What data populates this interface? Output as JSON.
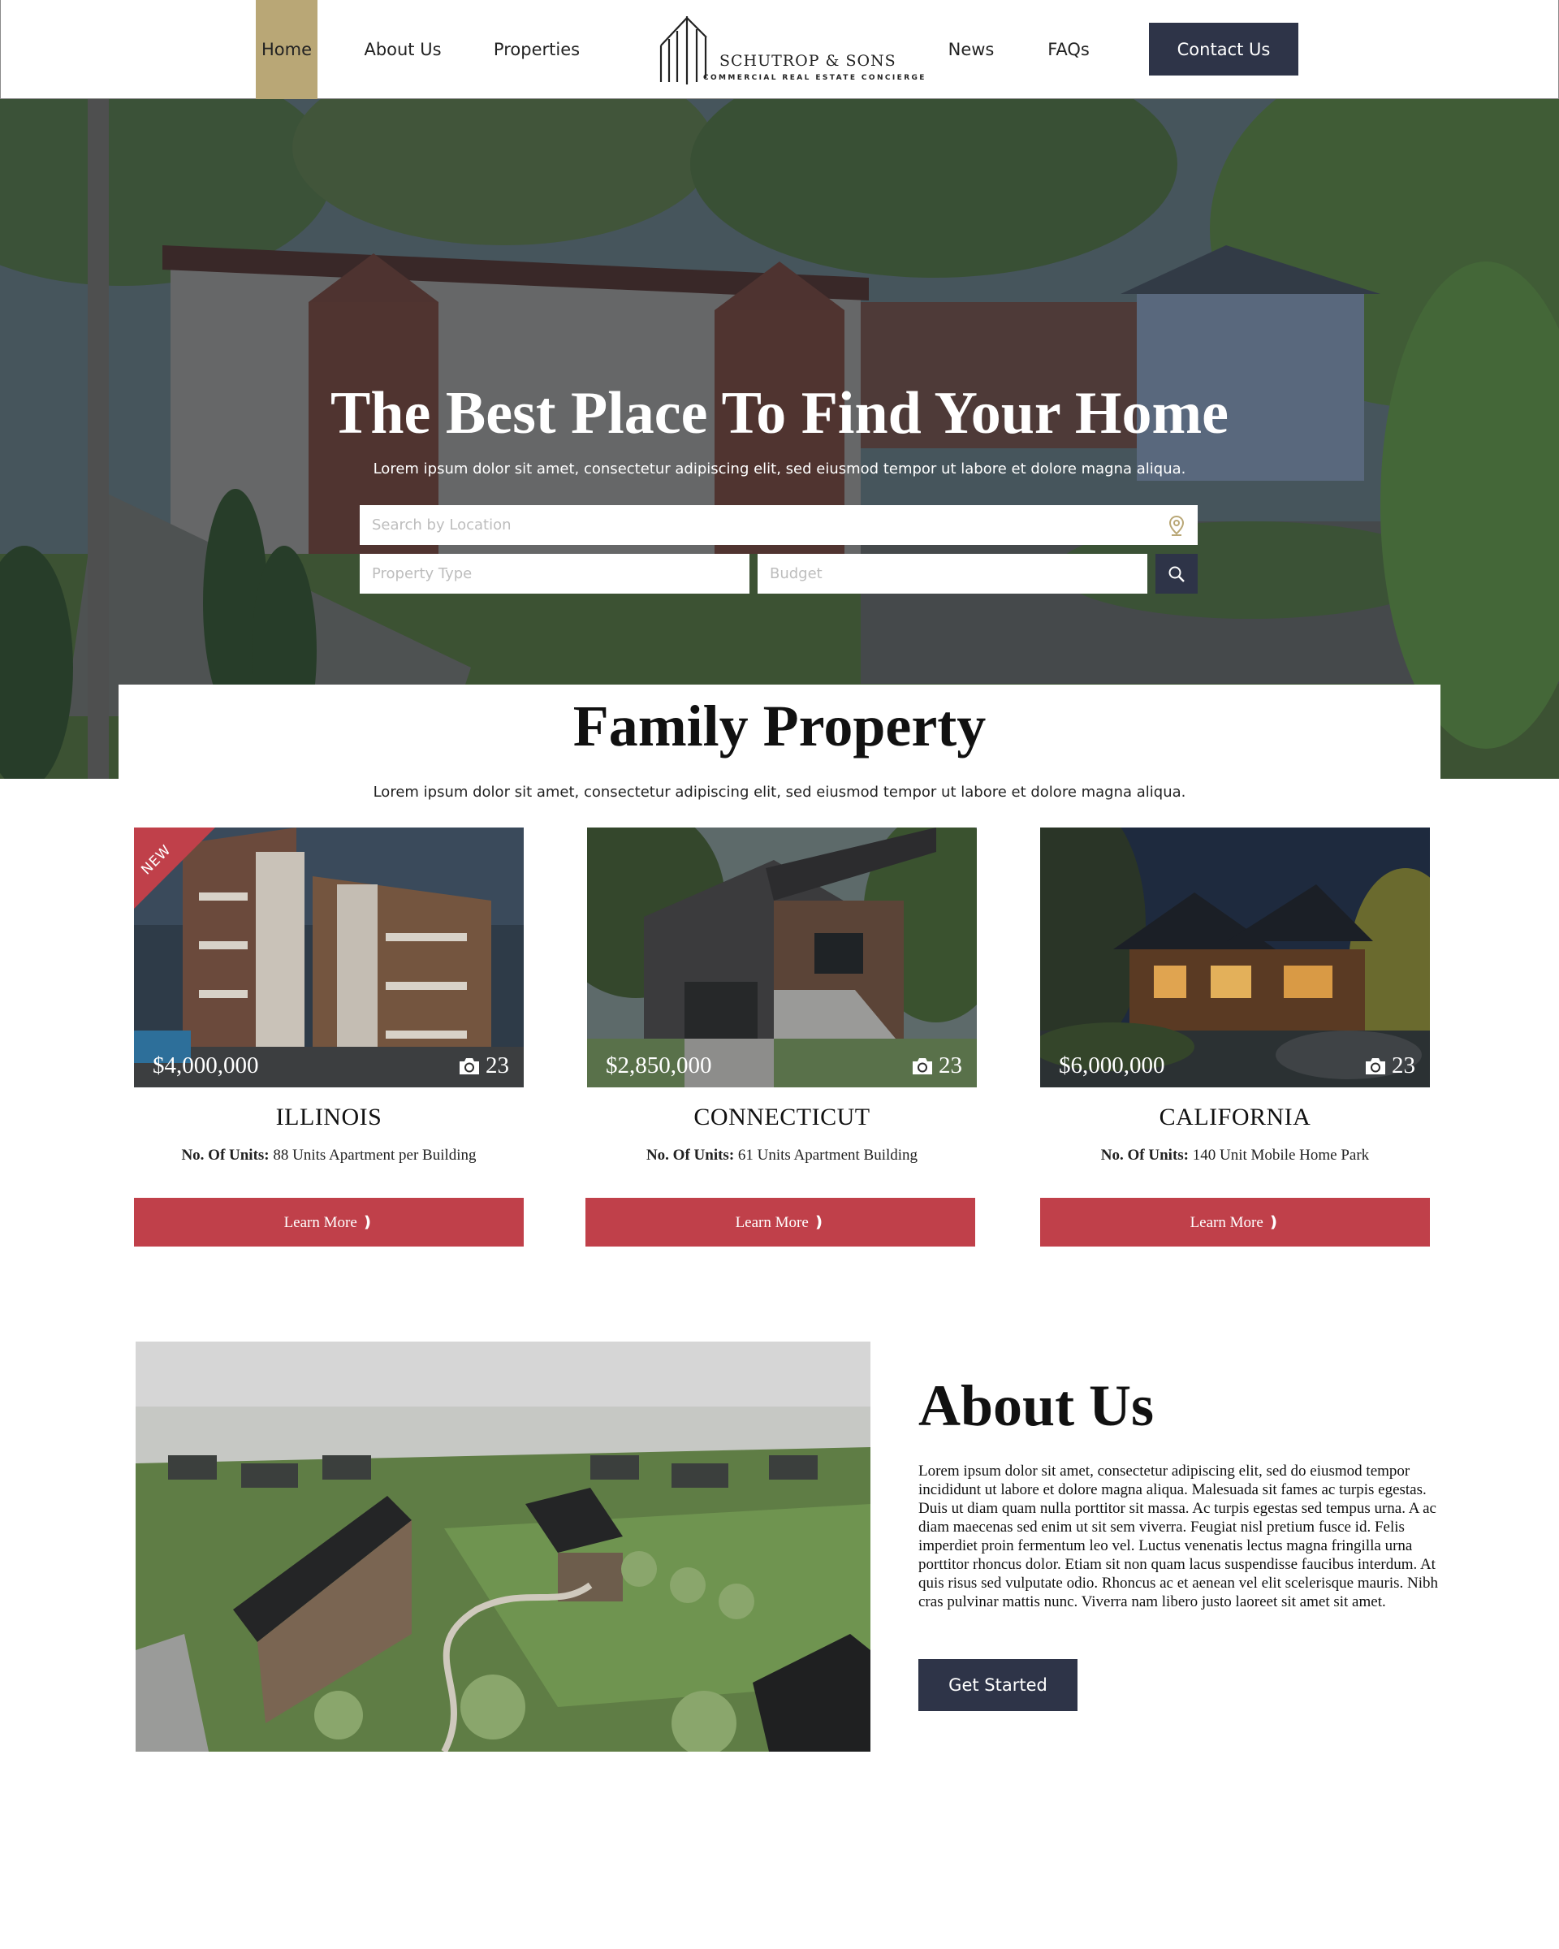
{
  "nav": {
    "items": [
      "Home",
      "About Us",
      "Properties",
      "News",
      "FAQs"
    ],
    "active": "Home",
    "contact_label": "Contact Us",
    "accent_color": "#b9a776",
    "button_color": "#2e3448"
  },
  "logo": {
    "name": "SCHUTROP & SONS",
    "tagline": "COMMERCIAL REAL ESTATE CONCIERGE"
  },
  "hero": {
    "title": "The Best Place To Find Your Home",
    "subtitle": "Lorem ipsum dolor sit amet, consectetur adipiscing elit, sed eiusmod tempor  ut labore et dolore magna aliqua.",
    "search": {
      "location_placeholder": "Search by Location",
      "type_placeholder": "Property Type",
      "budget_placeholder": "Budget"
    }
  },
  "family": {
    "title": "Family Property",
    "subtitle": "Lorem ipsum dolor sit amet, consectetur adipiscing elit, sed eiusmod tempor  ut labore et dolore magna aliqua.",
    "cards": [
      {
        "badge": "NEW",
        "price": "$4,000,000",
        "photos": "23",
        "state": "ILLINOIS",
        "units_label": "No. Of Units:",
        "units": "88 Units Apartment per Building",
        "button": "Learn More ❫"
      },
      {
        "price": "$2,850,000",
        "photos": "23",
        "state": "CONNECTICUT",
        "units_label": "No. Of Units:",
        "units": "61 Units Apartment Building",
        "button": "Learn More ❫"
      },
      {
        "price": "$6,000,000",
        "photos": "23",
        "state": "CALIFORNIA",
        "units_label": "No. Of Units:",
        "units": "140 Unit Mobile Home Park",
        "button": "Learn More ❫"
      }
    ],
    "button_color": "#c0404a"
  },
  "about": {
    "title": "About Us",
    "text": "Lorem ipsum dolor sit amet, consectetur adipiscing elit, sed do eiusmod tempor incididunt ut labore et dolore magna aliqua. Malesuada sit fames ac turpis egestas. Duis ut diam quam nulla porttitor sit massa. Ac turpis egestas sed tempus urna. A ac diam maecenas sed enim ut sit sem viverra. Feugiat nisl pretium fusce id. Felis imperdiet proin fermentum leo vel. Luctus venenatis lectus magna fringilla urna porttitor rhoncus dolor. Etiam sit non quam lacus suspendisse faucibus interdum. At quis risus sed vulputate odio. Rhoncus ac et aenean vel elit scelerisque mauris. Nibh cras pulvinar mattis nunc. Viverra nam libero justo laoreet sit amet sit amet.",
    "button": "Get Started"
  }
}
